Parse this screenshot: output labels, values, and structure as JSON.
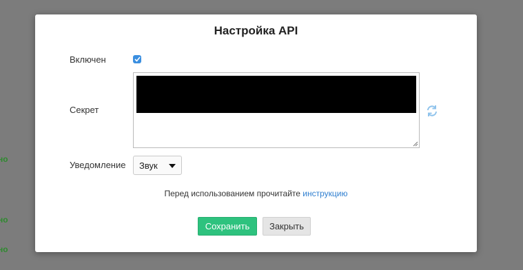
{
  "background": {
    "fragments": [
      "но",
      "но",
      "но"
    ]
  },
  "dialog": {
    "title": "Настройка API",
    "enabled": {
      "label": "Включен",
      "checked": true
    },
    "secret": {
      "label": "Секрет",
      "value": "",
      "refresh_icon": "refresh-icon"
    },
    "notification": {
      "label": "Уведомление",
      "selected": "Звук"
    },
    "hint": {
      "text": "Перед использованием прочитайте ",
      "link": "инструкцию"
    },
    "buttons": {
      "save": "Сохранить",
      "close": "Закрыть"
    }
  },
  "colors": {
    "accent": "#2ec27e",
    "link": "#2f7fd0",
    "checkbox": "#3b8fe0",
    "overlay": "#7c7c7c"
  }
}
